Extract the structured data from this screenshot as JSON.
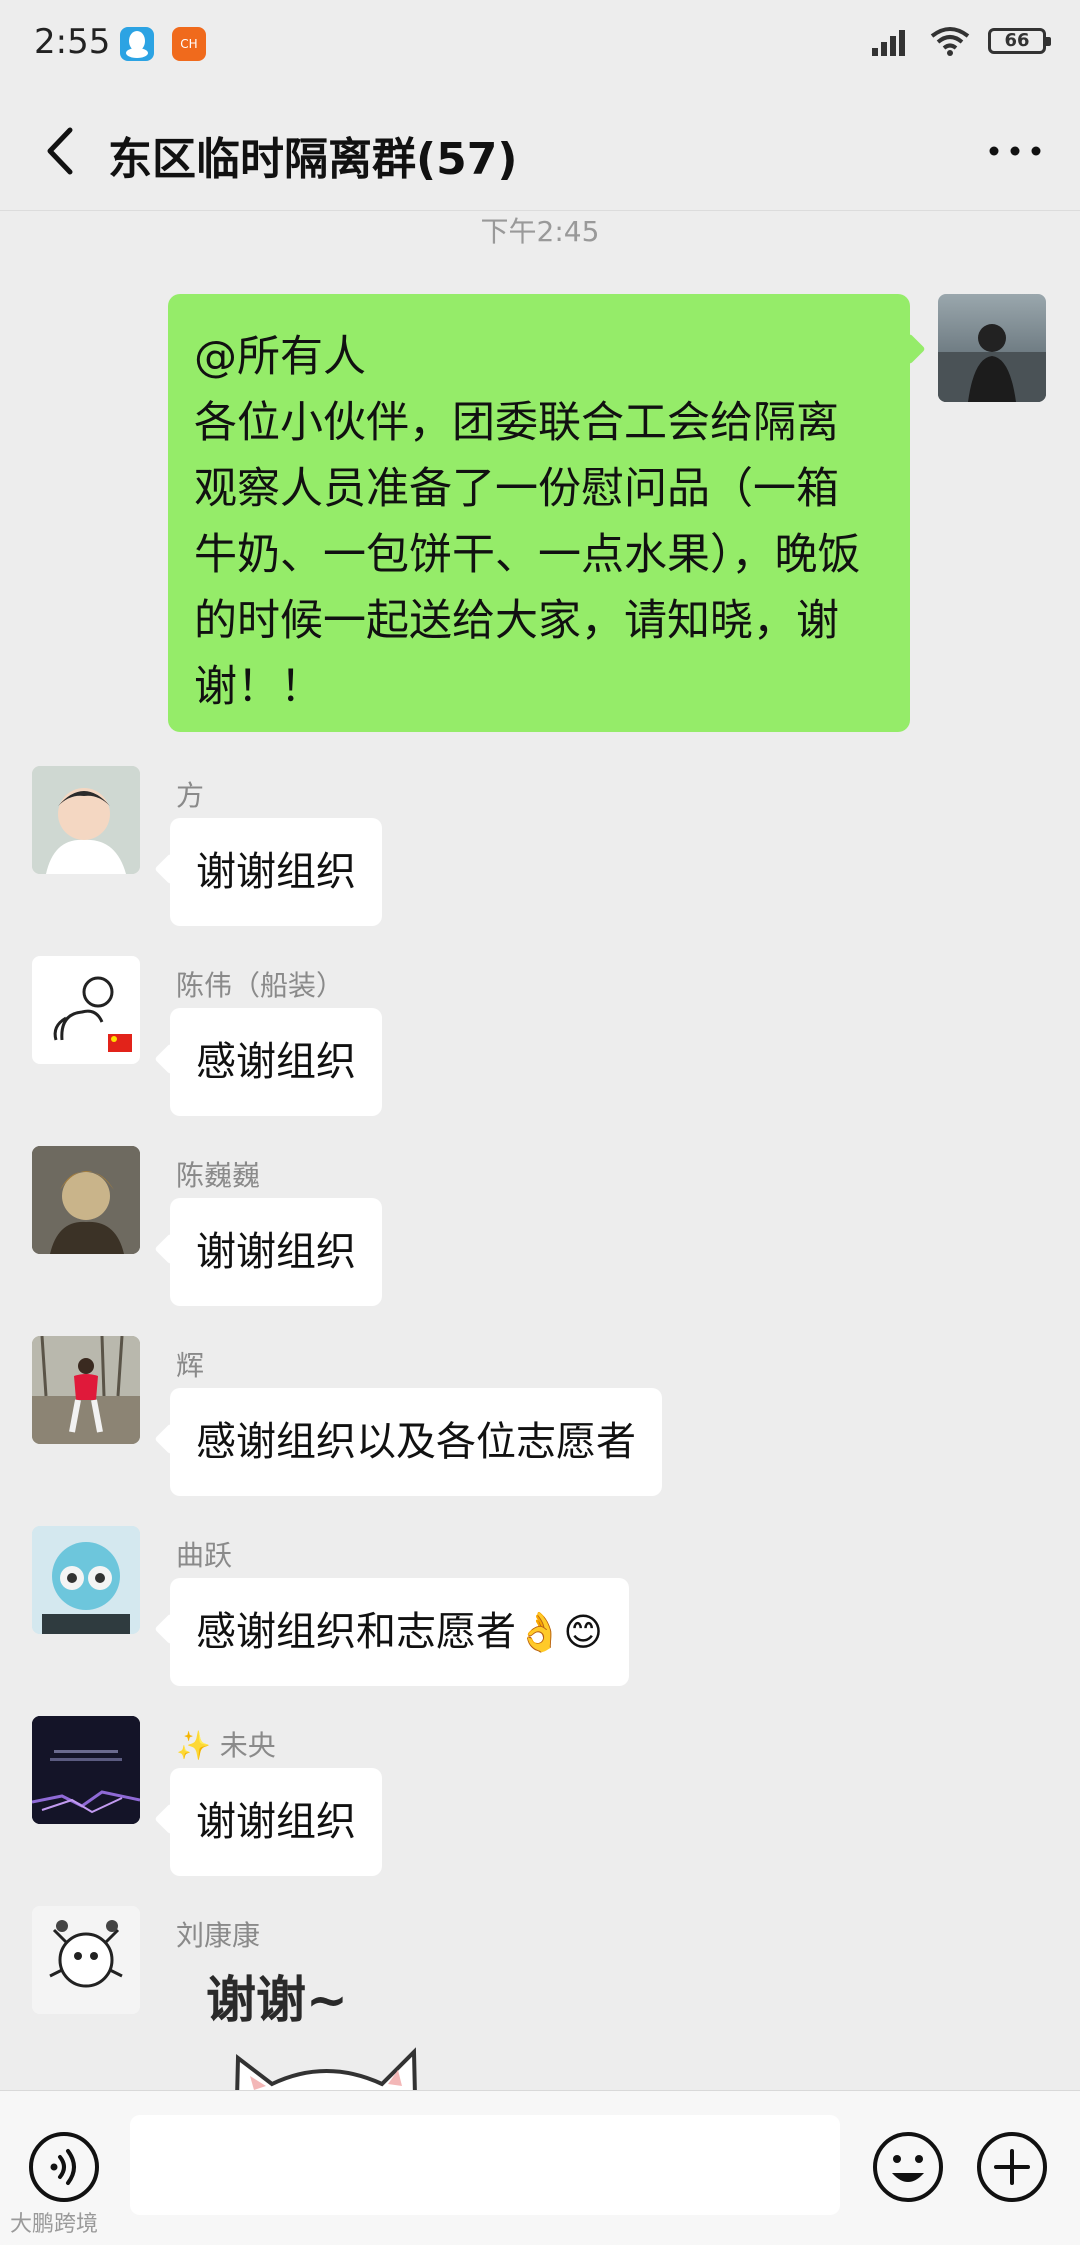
{
  "status_bar": {
    "time": "2:55",
    "battery": "66",
    "app_icon_label": "CH"
  },
  "header": {
    "title": "东区临时隔离群(57)"
  },
  "chat": {
    "timestamp": "下午2:45",
    "my_message": {
      "lines": [
        "@所有人",
        "各位小伙伴，团委联合工会给隔离",
        "观察人员准备了一份慰问品（一箱",
        "牛奶、一包饼干、一点水果），晚饭",
        "的时候一起送给大家，请知晓，谢",
        "谢！！"
      ]
    },
    "messages": [
      {
        "name": "方",
        "text": "谢谢组织"
      },
      {
        "name": "陈伟（船装）",
        "text": "感谢组织"
      },
      {
        "name": "陈巍巍",
        "text": "谢谢组织"
      },
      {
        "name": "辉",
        "text": "感谢组织以及各位志愿者"
      },
      {
        "name": "曲跃",
        "text": "感谢组织和志愿者",
        "emoji": "👌😊"
      },
      {
        "name": "✨ 未央",
        "text": "谢谢组织"
      },
      {
        "name": "刘康康",
        "sticker_text": "谢谢~"
      }
    ]
  },
  "input_bar": {
    "placeholder": ""
  },
  "watermark": "大鹏跨境",
  "colors": {
    "background": "#ededed",
    "my_bubble": "#95ec69",
    "other_bubble": "#ffffff"
  }
}
